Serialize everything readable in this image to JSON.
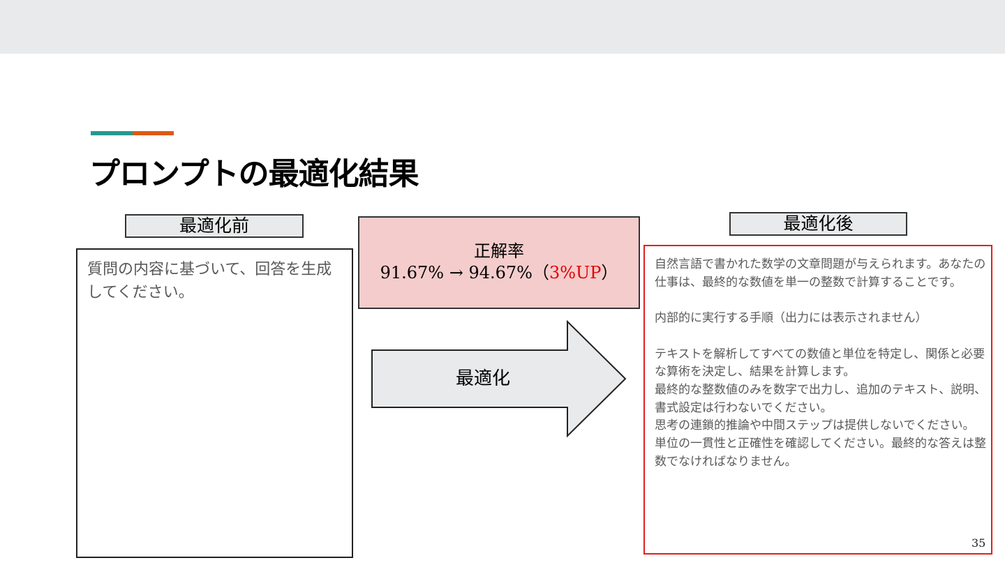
{
  "slide": {
    "title": "プロンプトの最適化結果",
    "page_number": "35",
    "colors": {
      "accent_teal": "#26998f",
      "accent_orange": "#dd5a12",
      "highlight_red": "#e30000",
      "accuracy_fill": "#f4cccc",
      "label_fill": "#e8eaeb"
    }
  },
  "before": {
    "label": "最適化前",
    "prompt": "質問の内容に基づいて、回答を生成してください。"
  },
  "accuracy": {
    "heading": "正解率",
    "change": "91.67% → 94.67%（",
    "improvement": "3%UP",
    "suffix": "）"
  },
  "arrow": {
    "label": "最適化"
  },
  "after": {
    "label": "最適化後",
    "prompt": "自然言語で書かれた数学の文章問題が与えられます。あなたの仕事は、最終的な数値を単一の整数で計算することです。\n\n内部的に実行する手順（出力には表示されません）\n\nテキストを解析してすべての数値と単位を特定し、関係と必要な算術を決定し、結果を計算します。\n最終的な整数値のみを数字で出力し、追加のテキスト、説明、書式設定は行わないでください。\n思考の連鎖的推論や中間ステップは提供しないでください。\n単位の一貫性と正確性を確認してください。最終的な答えは整数でなければなりません。"
  }
}
